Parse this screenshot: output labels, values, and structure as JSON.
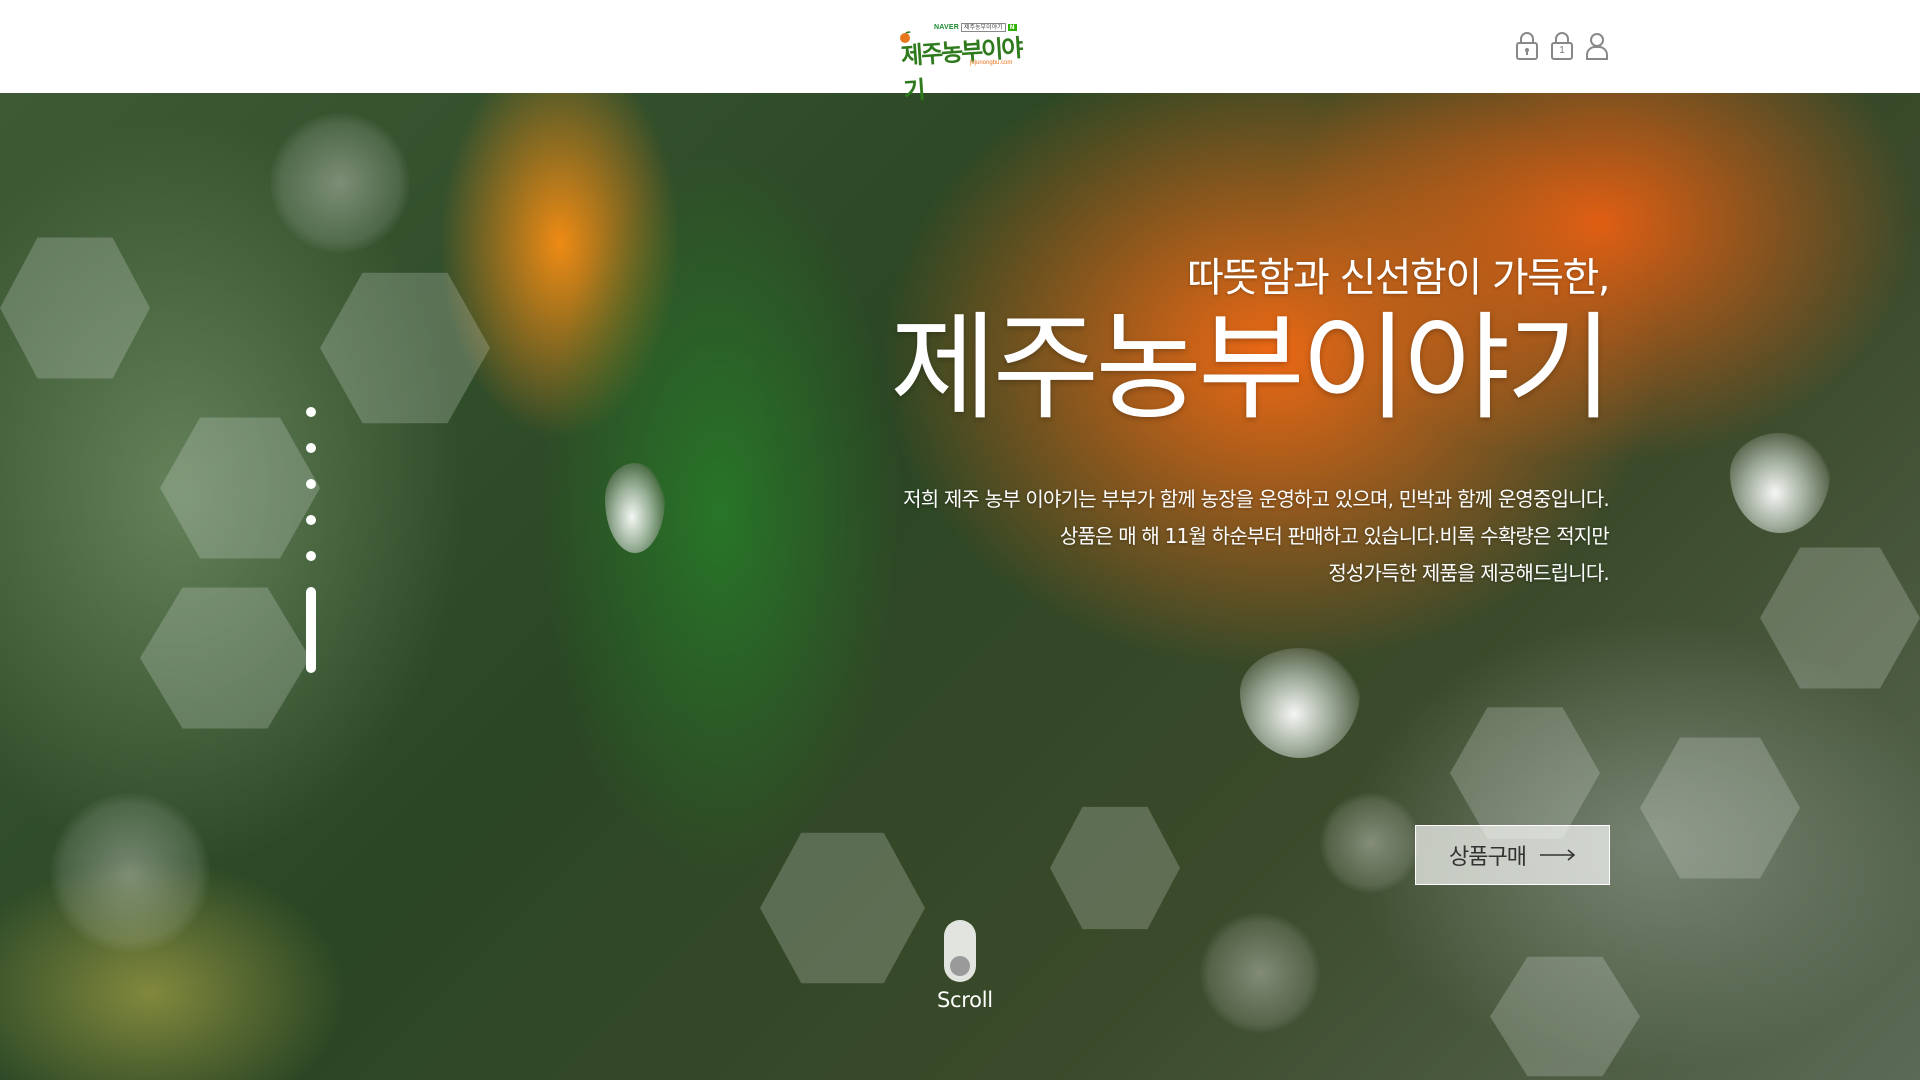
{
  "header": {
    "logo": {
      "naver_label": "NAVER",
      "naver_tag": "제주농부이야기",
      "naver_badge": "N",
      "name": "제주농부이야기",
      "url": "jejunongbu.com"
    },
    "icons": [
      {
        "name": "lock-icon",
        "badge": ""
      },
      {
        "name": "cart-icon",
        "badge": "1"
      },
      {
        "name": "user-icon",
        "badge": ""
      }
    ]
  },
  "hero": {
    "subtitle": "따뜻함과 신선함이 가득한,",
    "title": "제주농부이야기",
    "description": [
      "저희 제주 농부 이야기는 부부가 함께 농장을 운영하고 있으며, 민박과 함께 운영중입니다.",
      "상품은 매 해 11월 하순부터 판매하고 있습니다.비록 수확량은 적지만",
      "정성가득한 제품을 제공해드립니다."
    ],
    "buy_button": "상품구매",
    "scroll_label": "Scroll"
  },
  "pager": {
    "count": 6,
    "active_index": 5
  },
  "colors": {
    "accent_green": "#2f7a1c",
    "accent_orange": "#e8771e",
    "text_white": "#ffffff",
    "button_text": "#333333"
  }
}
